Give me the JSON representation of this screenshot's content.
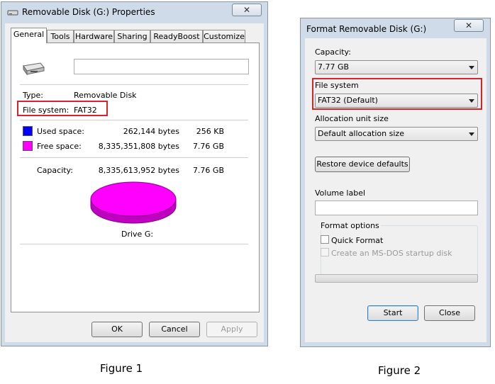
{
  "figure1": {
    "title": "Removable Disk (G:) Properties",
    "close_label": "✕",
    "tabs": [
      "General",
      "Tools",
      "Hardware",
      "Sharing",
      "ReadyBoost",
      "Customize"
    ],
    "icon": "usb-drive-icon",
    "type_label": "Type:",
    "type_value": "Removable Disk",
    "fs_label": "File system:",
    "fs_value": "FAT32",
    "used_label": "Used space:",
    "used_bytes": "262,144 bytes",
    "used_size": "256 KB",
    "used_color": "#0000ff",
    "free_label": "Free space:",
    "free_bytes": "8,335,351,808 bytes",
    "free_size": "7.76 GB",
    "free_color": "#ff00ff",
    "capacity_label": "Capacity:",
    "capacity_bytes": "8,335,613,952 bytes",
    "capacity_size": "7.76 GB",
    "drive_label": "Drive G:",
    "ok": "OK",
    "cancel": "Cancel",
    "apply": "Apply",
    "caption": "Figure 1"
  },
  "figure2": {
    "title": "Format Removable Disk (G:)",
    "close_label": "✕",
    "capacity_label": "Capacity:",
    "capacity_value": "7.77 GB",
    "fs_label": "File system",
    "fs_value": "FAT32 (Default)",
    "alloc_label": "Allocation unit size",
    "alloc_value": "Default allocation size",
    "restore_button": "Restore device defaults",
    "volume_label": "Volume label",
    "volume_value": "",
    "format_options_label": "Format options",
    "quick_format": "Quick Format",
    "msdos": "Create an MS-DOS startup disk",
    "start": "Start",
    "close": "Close",
    "caption": "Figure 2"
  },
  "colors": {
    "highlight": "#d9232a",
    "title_bar": "#cfdbe9"
  }
}
